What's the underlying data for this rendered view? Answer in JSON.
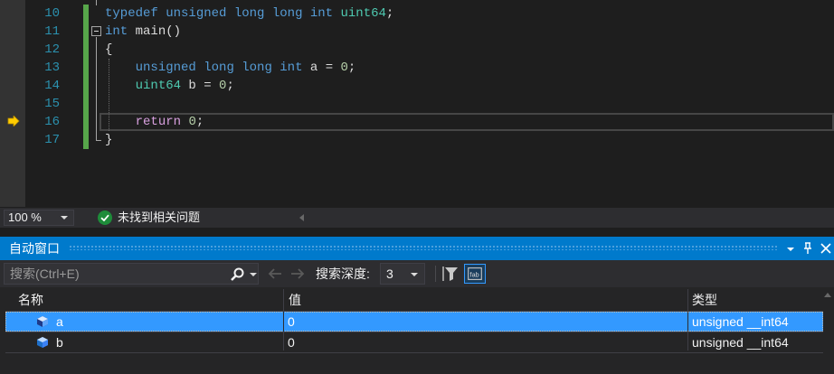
{
  "editor": {
    "lines": [
      {
        "n": "10",
        "code": "typedef unsigned long long int uint64;"
      },
      {
        "n": "11",
        "code": "int main()"
      },
      {
        "n": "12",
        "code": "{"
      },
      {
        "n": "13",
        "code": "    unsigned long long int a = 0;"
      },
      {
        "n": "14",
        "code": "    uint64 b = 0;"
      },
      {
        "n": "15",
        "code": ""
      },
      {
        "n": "16",
        "code": "    return 0;"
      },
      {
        "n": "17",
        "code": "}"
      }
    ],
    "current_line": "16",
    "breakpoint_icon": "instruction-pointer-arrow-icon"
  },
  "status": {
    "zoom": "100 %",
    "issues_text": "未找到相关问题",
    "issues_icon": "check-circle-icon"
  },
  "autos": {
    "title": "自动窗口",
    "title_buttons": [
      "dropdown-icon",
      "pin-icon",
      "close-icon"
    ],
    "search_placeholder": "搜索(Ctrl+E)",
    "search_depth_label": "搜索深度:",
    "search_depth_value": "3",
    "columns": {
      "name": "名称",
      "value": "值",
      "type": "类型"
    },
    "rows": [
      {
        "name": "a",
        "value": "0",
        "type": "unsigned __int64",
        "selected": true
      },
      {
        "name": "b",
        "value": "0",
        "type": "unsigned __int64",
        "selected": false
      }
    ]
  },
  "colors": {
    "accent": "#007acc",
    "selection": "#3399ff",
    "keyword": "#569cd6",
    "type": "#4ec9b0",
    "control": "#d8a0df",
    "number": "#b5cea8",
    "line_number": "#2b91af",
    "changed_bar": "#57a64a"
  }
}
